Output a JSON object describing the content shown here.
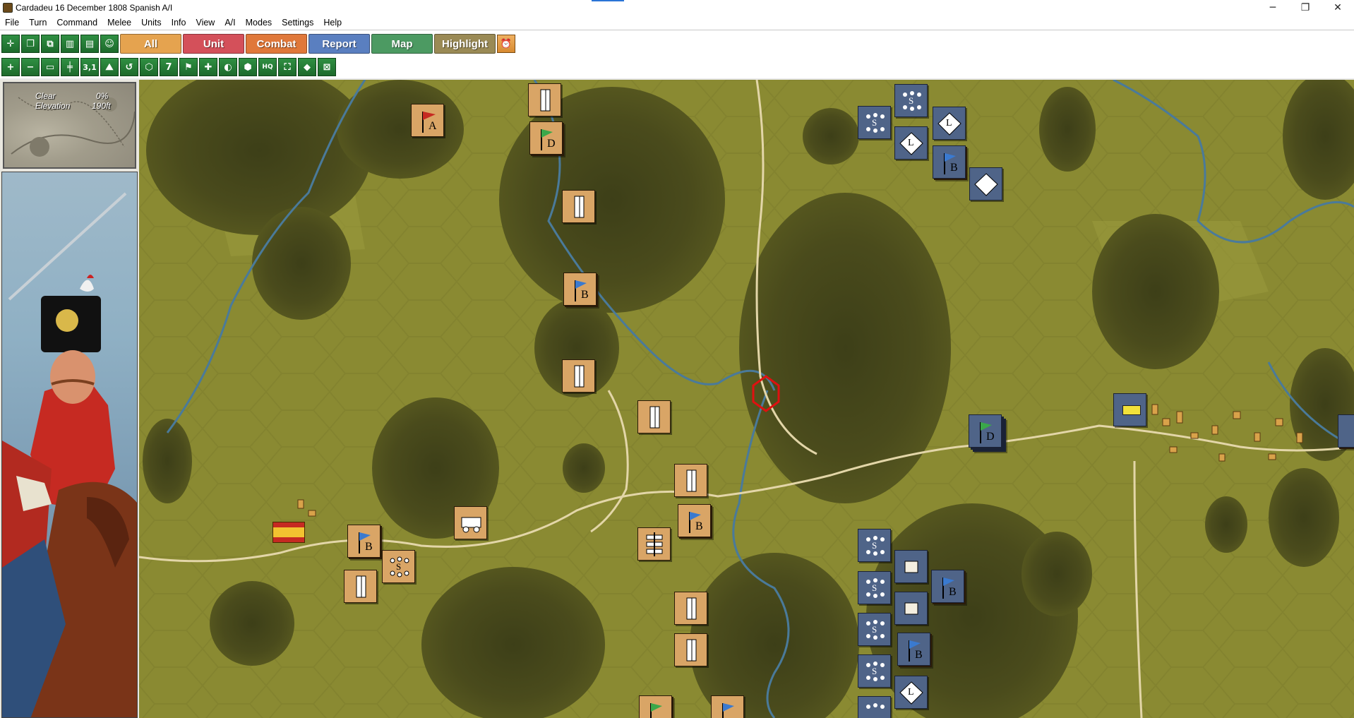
{
  "window": {
    "title": "Cardadeu 16 December 1808 Spanish A/I",
    "controls": {
      "minimize": "─",
      "restore": "❐",
      "close": "✕"
    }
  },
  "menu": [
    "File",
    "Turn",
    "Command",
    "Melee",
    "Units",
    "Info",
    "View",
    "A/I",
    "Modes",
    "Settings",
    "Help"
  ],
  "toolbar_top": {
    "tabs": [
      {
        "label": "All",
        "color": "#e5a34f"
      },
      {
        "label": "Unit",
        "color": "#d4505a"
      },
      {
        "label": "Combat",
        "color": "#e0783a"
      },
      {
        "label": "Report",
        "color": "#5a7fc0"
      },
      {
        "label": "Map",
        "color": "#4c9a62"
      },
      {
        "label": "Highlight",
        "color": "#9a8a55"
      }
    ]
  },
  "toolbar_bottom": {
    "labels": {
      "zoom_level": "3,1",
      "number_7": "7",
      "hq": "HQ"
    }
  },
  "terrain_info": {
    "weather_label": "Clear",
    "weather_value": "0%",
    "elevation_label": "Elevation",
    "elevation_value": "190ft"
  },
  "counters": {
    "spanish_a": "A",
    "spanish_d": "D",
    "spanish_b": "B",
    "french_s": "S",
    "french_l": "L",
    "french_b": "B",
    "french_d": "D"
  },
  "colors": {
    "spanish_counter": "#d9a566",
    "french_counter": "#4f6488",
    "map_grass": "#8a8a32",
    "selection_hex": "#e01010"
  }
}
